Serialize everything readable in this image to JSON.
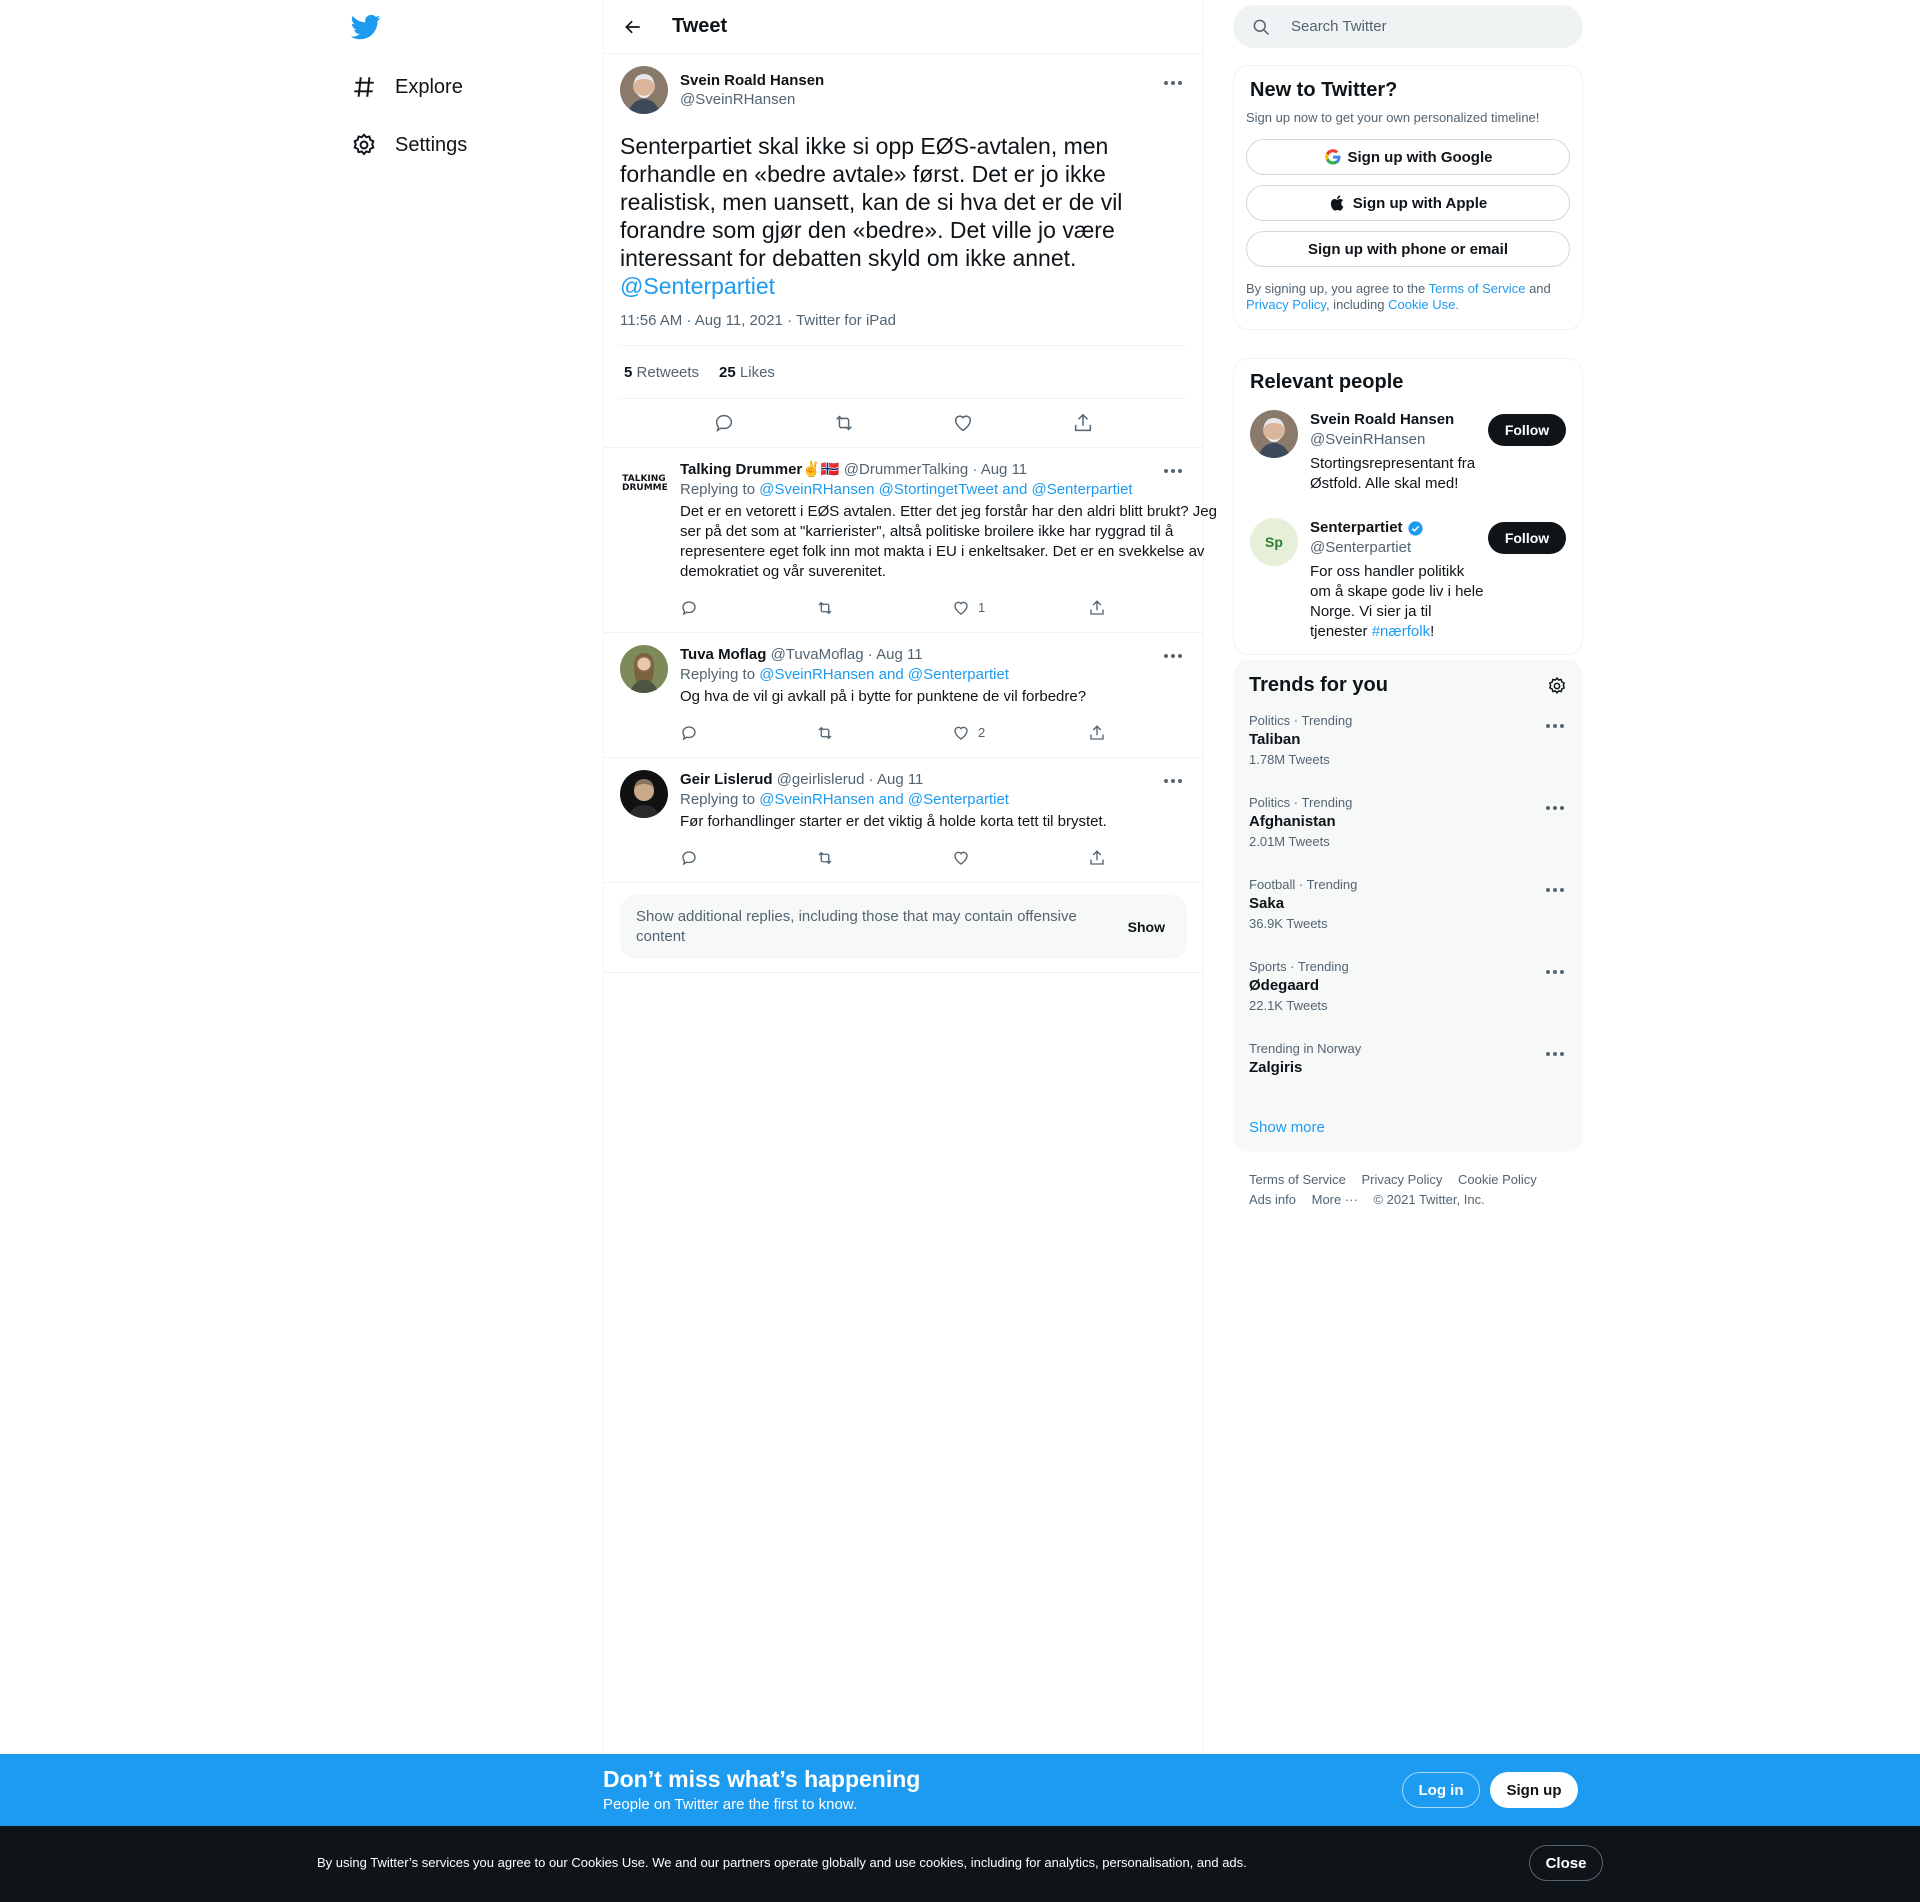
{
  "nav": {
    "items": [
      {
        "label": "Explore",
        "icon": "hashtag-icon"
      },
      {
        "label": "Settings",
        "icon": "gear-icon"
      }
    ]
  },
  "header": {
    "title": "Tweet"
  },
  "tweet": {
    "author_name": "Svein Roald Hansen",
    "author_handle": "@SveinRHansen",
    "text": "Senterpartiet skal ikke si opp EØS-avtalen, men forhandle en «bedre avtale» først. Det er jo ikke realistisk, men uansett, kan de si hva det er de vil forandre som gjør den «bedre». Det ville jo være interessant for debatten skyld om ikke annet.",
    "mention": "@Senterpartiet",
    "meta": "11:56 AM · Aug 11, 2021 · Twitter for iPad",
    "retweets_count": "5",
    "retweets_label": "Retweets",
    "likes_count": "25",
    "likes_label": "Likes"
  },
  "replies": [
    {
      "name": "Talking Drummer",
      "name_emoji": "✌🇳🇴",
      "handle": "@DrummerTalking",
      "date": "· Aug 11",
      "replying_prefix": "Replying to",
      "replying_to": "@SveinRHansen @StortingetTweet and @Senterpartiet",
      "text": "Det er en vetorett i EØS avtalen. Etter det jeg forstår har den aldri blitt brukt? Jeg ser på det som at \"karrierister\", altså politiske broilere ikke har ryggrad til å representere eget folk inn mot makta i EU i enkeltsaker. Det er en svekkelse av demokratiet og vår suverenitet.",
      "likes": "1",
      "avatar_text": "TALKING DRUMMER"
    },
    {
      "name": "Tuva Moflag",
      "name_emoji": "",
      "handle": "@TuvaMoflag",
      "date": "· Aug 11",
      "replying_prefix": "Replying to",
      "replying_to": "@SveinRHansen and @Senterpartiet",
      "text": "Og hva de vil gi avkall på i bytte for punktene de vil forbedre?",
      "likes": "2"
    },
    {
      "name": "Geir Lislerud",
      "name_emoji": "",
      "handle": "@geirlislerud",
      "date": "· Aug 11",
      "replying_prefix": "Replying to",
      "replying_to": "@SveinRHansen and @Senterpartiet",
      "text": "Før forhandlinger starter er det viktig å holde korta tett til brystet.",
      "likes": ""
    }
  ],
  "show_more": {
    "text": "Show additional replies, including those that may contain offensive content",
    "button": "Show"
  },
  "search": {
    "placeholder": "Search Twitter"
  },
  "signup_card": {
    "title": "New to Twitter?",
    "subtitle": "Sign up now to get your own personalized timeline!",
    "google": "Sign up with Google",
    "apple": "Sign up with Apple",
    "phone": "Sign up with phone or email",
    "legal_1": "By signing up, you agree to the",
    "tos": "Terms of Service",
    "legal_2": "and",
    "privacy": "Privacy Policy",
    "legal_3": ", including",
    "cookie": "Cookie Use."
  },
  "relevant": {
    "title": "Relevant people",
    "people": [
      {
        "name": "Svein Roald Hansen",
        "handle": "@SveinRHansen",
        "bio": "Stortingsrepresentant fra Østfold. Alle skal med!",
        "follow": "Follow"
      },
      {
        "name": "Senterpartiet",
        "handle": "@Senterpartiet",
        "bio_1": "For oss handler politikk om å skape gode liv i hele Norge. Vi sier ja til tjenester",
        "bio_tag": "#nærfolk",
        "bio_2": "!",
        "follow": "Follow",
        "avatar_text": "Sp"
      }
    ]
  },
  "trends": {
    "title": "Trends for you",
    "items": [
      {
        "cat": "Politics · Trending",
        "name": "Taliban",
        "count": "1.78M Tweets"
      },
      {
        "cat": "Politics · Trending",
        "name": "Afghanistan",
        "count": "2.01M Tweets"
      },
      {
        "cat": "Football · Trending",
        "name": "Saka",
        "count": "36.9K Tweets"
      },
      {
        "cat": "Sports · Trending",
        "name": "Ødegaard",
        "count": "22.1K Tweets"
      },
      {
        "cat": "Trending in Norway",
        "name": "Zalgiris",
        "count": ""
      }
    ],
    "show_more": "Show more"
  },
  "footer": {
    "links": [
      "Terms of Service",
      "Privacy Policy",
      "Cookie Policy",
      "Ads info",
      "More ···"
    ],
    "copyright": "© 2021 Twitter, Inc."
  },
  "bottom_bar": {
    "title": "Don’t miss what’s happening",
    "subtitle": "People on Twitter are the first to know.",
    "login": "Log in",
    "signup": "Sign up"
  },
  "cookie_bar": {
    "text": "By using Twitter’s services you agree to our Cookies Use. We and our partners operate globally and use cookies, including for analytics, personalisation, and ads.",
    "close": "Close"
  },
  "colors": {
    "accent": "#1d9bf0",
    "text": "#0f1419",
    "secondary": "#536471",
    "verified": "#1d9bf0"
  }
}
